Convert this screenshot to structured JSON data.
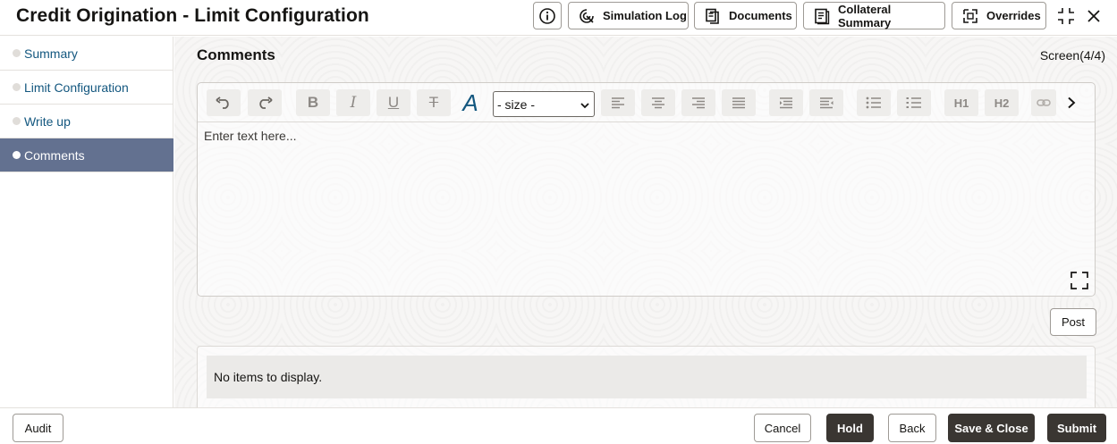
{
  "header": {
    "title": "Credit Origination - Limit Configuration",
    "buttons": {
      "simulation_log": "Simulation Log",
      "documents": "Documents",
      "collateral_summary": "Collateral Summary",
      "overrides": "Overrides"
    }
  },
  "sidebar": {
    "items": [
      {
        "label": "Summary"
      },
      {
        "label": "Limit Configuration"
      },
      {
        "label": "Write up"
      },
      {
        "label": "Comments"
      }
    ],
    "active_index": 3
  },
  "main": {
    "section_title": "Comments",
    "screen_indicator": "Screen(4/4)",
    "editor": {
      "size_select_value": "- size -",
      "placeholder": "Enter text here...",
      "toolbar_labels": {
        "h1": "H1",
        "h2": "H2"
      }
    },
    "post_label": "Post",
    "empty_message": "No items to display."
  },
  "footer": {
    "audit_label": "Audit",
    "cancel_label": "Cancel",
    "hold_label": "Hold",
    "back_label": "Back",
    "save_close_label": "Save & Close",
    "submit_label": "Submit"
  },
  "colors": {
    "active_nav_bg": "#637190",
    "nav_link": "#13577f",
    "dark_button": "#3a3632"
  }
}
